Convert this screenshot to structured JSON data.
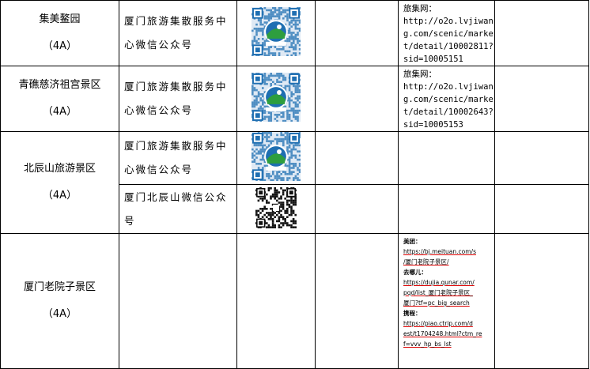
{
  "rows": [
    {
      "scenic_name": "集美鳌园",
      "rating": "（4A）",
      "service_lines": [
        "厦门旅游集散服务中",
        "心微信公众号"
      ],
      "qr_type": "official-blue",
      "link_label": "旅集网：",
      "link_lines": [
        "http://o2o.lvjiwan",
        "g.com/scenic/marke",
        "t/detail/10002811?",
        "sid=10005151"
      ]
    },
    {
      "scenic_name": "青礁慈济祖宫景区",
      "rating": "（4A）",
      "service_lines": [
        "厦门旅游集散服务中",
        "心微信公众号"
      ],
      "qr_type": "official-blue",
      "link_label": "旅集网：",
      "link_lines": [
        "http://o2o.lvjiwan",
        "g.com/scenic/marke",
        "t/detail/10002643?",
        "sid=10005153"
      ]
    },
    {
      "scenic_name": "北辰山旅游景区",
      "rating": "（4A）",
      "service_lines": [
        "厦门旅游集散服务中",
        "心微信公众号"
      ],
      "qr_type": "official-blue",
      "service2_lines": [
        "厦门北辰山微信公众",
        "号"
      ],
      "qr2_type": "plain-black"
    },
    {
      "scenic_name": "厦门老院子景区",
      "rating": "（4A）",
      "small_links": [
        {
          "head": "美团：",
          "lines": [
            "https://bj.meituan.com/s",
            "/厦门老院子景区/"
          ]
        },
        {
          "head": "去哪儿：",
          "lines": [
            "https://dujia.qunar.com/",
            "pqd/list_厦门老院子景区_",
            "厦门?tf=pc_big_search"
          ]
        },
        {
          "head": "携程：",
          "lines": [
            "https://piao.ctrip.com/d",
            "est/t1704248.html?ctm_re",
            "f=vvv_hp_bs_lst"
          ]
        }
      ]
    }
  ],
  "colors": {
    "border": "#000000",
    "qr_blue": "#1f6fb2",
    "qr_green": "#2e9e3e",
    "underline": "#dd0000"
  }
}
